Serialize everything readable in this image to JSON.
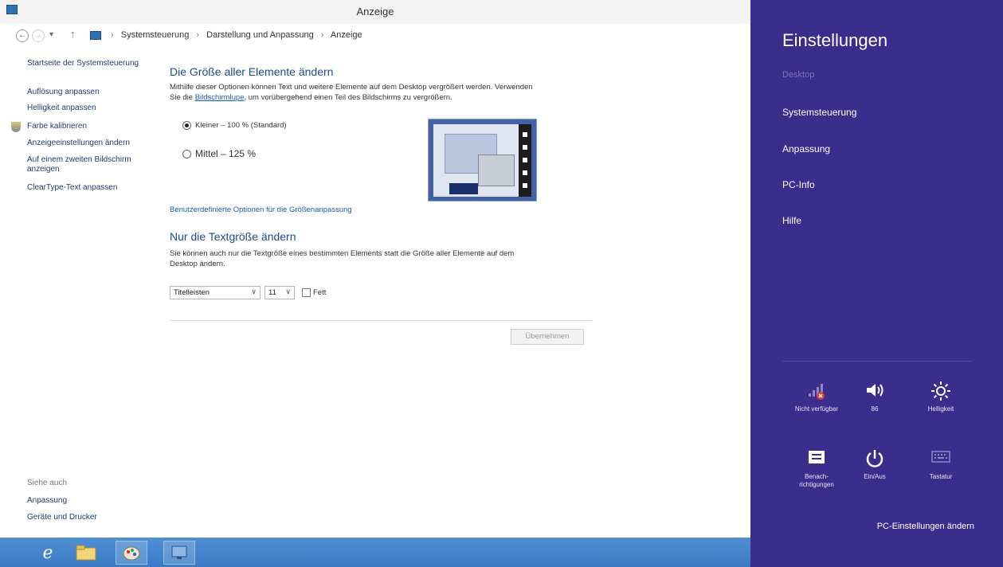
{
  "window": {
    "title": "Anzeige"
  },
  "addressbar": {
    "crumbs": [
      "Systemsteuerung",
      "Darstellung und Anpassung",
      "Anzeige"
    ],
    "sep": "›"
  },
  "leftnav": {
    "home": "Startseite der Systemsteuerung",
    "items": [
      "Auflösung anpassen",
      "Helligkeit anpassen",
      "Farbe kalibrieren",
      "Anzeigeeinstellungen ändern",
      "Auf einem zweiten Bildschirm anzeigen",
      "ClearType-Text anpassen"
    ],
    "see_also_title": "Siehe auch",
    "see_also": [
      "Anpassung",
      "Geräte und Drucker"
    ]
  },
  "main": {
    "section1_title": "Die Größe aller Elemente ändern",
    "section1_desc_a": "Mithilfe dieser Optionen können Text und weitere Elemente auf dem Desktop vergrößert werden. Verwenden",
    "section1_desc_b": "Sie die",
    "section1_desc_link": "Bildschirmlupe",
    "section1_desc_c": ", um vorübergehend einen Teil des Bildschirms zu vergrößern.",
    "option_small": "Kleiner – 100 % (Standard)",
    "option_medium": "Mittel – 125 %",
    "custom_link": "Benutzerdefinierte Optionen für die Größenanpassung",
    "section2_title": "Nur die Textgröße ändern",
    "section2_desc_a": "Sie können auch nur die Textgröße eines bestimmten Elements statt die Größe aller Elemente auf dem",
    "section2_desc_b": "Desktop ändern.",
    "element_select": "Titelleisten",
    "size_select": "11",
    "bold_label": "Fett",
    "apply_button": "Übernehmen"
  },
  "charms": {
    "title": "Einstellungen",
    "context": "Desktop",
    "items": [
      "Systemsteuerung",
      "Anpassung",
      "PC-Info",
      "Hilfe"
    ],
    "tiles": [
      {
        "icon": "network-unavailable-icon",
        "label": "Nicht verfügbar"
      },
      {
        "icon": "volume-icon",
        "label": "86"
      },
      {
        "icon": "brightness-icon",
        "label": "Helligkeit"
      },
      {
        "icon": "notifications-icon",
        "label": "Benach-richtigungen"
      },
      {
        "icon": "power-icon",
        "label": "Ein/Aus"
      },
      {
        "icon": "keyboard-icon",
        "label": "Tastatur"
      }
    ],
    "footer": "PC-Einstellungen ändern"
  },
  "taskbar": {
    "items": [
      "internet-explorer-icon",
      "file-explorer-icon",
      "paint-icon",
      "control-panel-icon"
    ]
  },
  "colors": {
    "charms_bg": "#3b2d8c",
    "taskbar": "#3a7bc4",
    "link": "#1a5fb4",
    "title_blue": "#1e4b8c"
  }
}
